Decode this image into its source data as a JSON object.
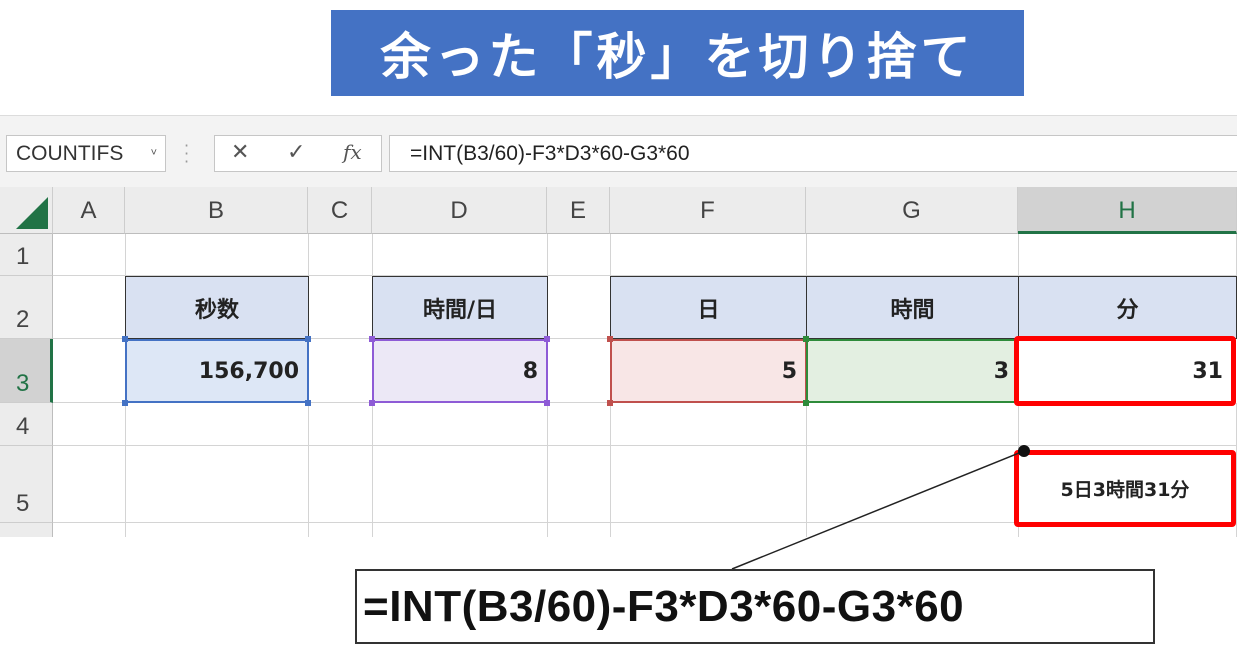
{
  "banner": {
    "title": "余った「秒」を切り捨て"
  },
  "formula_bar": {
    "name_box": "COUNTIFS",
    "name_box_arrow": "˅",
    "cancel_symbol": "✕",
    "enter_symbol": "✓",
    "fx_symbol": "fx",
    "formula": "=INT(B3/60)-F3*D3*60-G3*60"
  },
  "columns": [
    "A",
    "B",
    "C",
    "D",
    "E",
    "F",
    "G",
    "H"
  ],
  "rows": [
    "1",
    "2",
    "3",
    "4",
    "5"
  ],
  "headers": {
    "seconds": "秒数",
    "hours_per_day": "時間/日",
    "days": "日",
    "hours": "時間",
    "minutes": "分"
  },
  "values": {
    "seconds": "156,700",
    "hours_per_day": "8",
    "days": "5",
    "hours": "3",
    "minutes": "31"
  },
  "result": "5日3時間31分",
  "callout_formula": "=INT(B3/60)-F3*D3*60-G3*60",
  "colors": {
    "banner": "#4472c4",
    "header_fill": "#d9e1f2",
    "seconds_fill": "#dde7f6",
    "hours_per_day_fill": "#ece8f6",
    "days_fill": "#f8e6e6",
    "hours_fill": "#e3efe1",
    "highlight": "#ff0000",
    "excel_green": "#217346"
  }
}
